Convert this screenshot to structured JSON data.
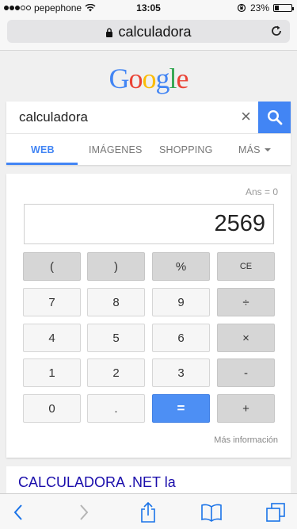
{
  "status_bar": {
    "carrier": "pepephone",
    "time": "13:05",
    "battery": "23%",
    "signal_bars_filled": 3,
    "signal_bars_total": 5
  },
  "browser": {
    "url_text": "calculadora",
    "icons": [
      "lock-icon",
      "reload-icon"
    ]
  },
  "google": {
    "logo_letters": [
      {
        "ch": "G",
        "color": "#4285f4"
      },
      {
        "ch": "o",
        "color": "#ea4335"
      },
      {
        "ch": "o",
        "color": "#fbbc05"
      },
      {
        "ch": "g",
        "color": "#4285f4"
      },
      {
        "ch": "l",
        "color": "#34a853"
      },
      {
        "ch": "e",
        "color": "#ea4335"
      }
    ],
    "search_query": "calculadora",
    "clear_glyph": "×",
    "tabs": [
      "WEB",
      "IMÁGENES",
      "SHOPPING",
      "MÁS"
    ],
    "active_tab": "WEB",
    "accent_color": "#4285f4"
  },
  "calculator": {
    "ans_label": "Ans = 0",
    "display_value": "2569",
    "rows": [
      [
        "(",
        ")",
        "%",
        "CE"
      ],
      [
        "7",
        "8",
        "9",
        "÷"
      ],
      [
        "4",
        "5",
        "6",
        "×"
      ],
      [
        "1",
        "2",
        "3",
        "-"
      ],
      [
        "0",
        ".",
        "=",
        "+"
      ]
    ],
    "more_info": "Más información"
  },
  "result": {
    "title": "CALCULADORA .NET la"
  },
  "toolbar": {
    "icons": [
      "back-icon",
      "forward-icon",
      "share-icon",
      "bookmarks-icon",
      "tabs-icon"
    ]
  }
}
